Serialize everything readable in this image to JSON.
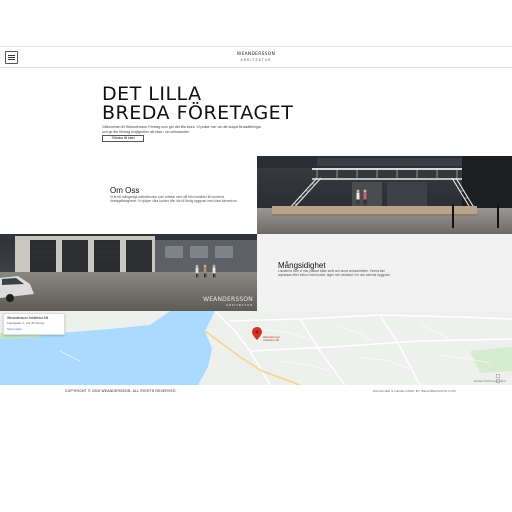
{
  "header": {
    "logo_main": "WEANDERSSON",
    "logo_sub": "ARKITEKTUR"
  },
  "hero": {
    "title_line1": "DET LILLA",
    "title_line2": "BREDA FÖRETAGET",
    "description": "Välkommen till Weandersson Företag som gör det lilla stora. Vi pratar mer om att skapa förutsättningar och ge fler företag möjligheten att växa i sin verksamhet.",
    "button_label": "Tillbaka till start"
  },
  "about": {
    "title": "Om Oss",
    "text": "Vi är ett mångsidigt arkitektkontor som arbetar med allt från bostäder till moderna företagsfastigheter. Vi hjälper våra kunder från idé till färdig byggnad med lokal kännedom."
  },
  "versatility": {
    "title": "Mångsidighet",
    "text": "Lokalerna som vi ritar passar både små och stora verksamheter. Ytorna kan anpassas efter behov med kontor, lager och verkstad i en och samma byggnad."
  },
  "photo2": {
    "watermark_main": "WEANDERSSON",
    "watermark_sub": "ARKITEKTUR"
  },
  "map": {
    "place_name": "Weandersson Arkitektur AB",
    "address": "Kapellgatan 1, 123 45 Sverige",
    "directions_link": "Större karta",
    "pin_label": "Weandersson Arkitektur AB",
    "attribution": "Kartdata ©2018 Google  Villkor"
  },
  "footer": {
    "copyright": "COPYRIGHT © 2018 WEANDERSSON. ALL RIGHTS RESERVED.",
    "credit": "DESIGNED & DEVELOPED BY WEANDERSSON.COM"
  },
  "colors": {
    "water": "#aadaff",
    "pin": "#d93025",
    "land": "#eef0ee"
  }
}
